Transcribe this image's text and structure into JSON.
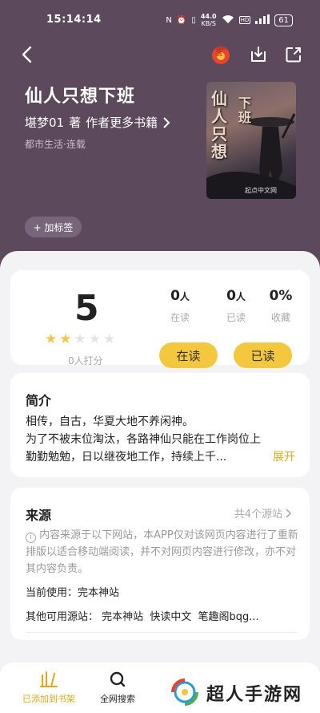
{
  "status_bar": {
    "time": "15:14:14",
    "net_speed": "44.0",
    "net_unit": "KB/S",
    "battery": "61"
  },
  "header": {
    "back_icon": "chevron-left-icon",
    "reward_icon": "red-envelope-icon",
    "reward_label": "赏",
    "download_icon": "download-icon",
    "share_icon": "share-icon"
  },
  "book": {
    "title": "仙人只想下班",
    "author": "堪梦01",
    "author_suffix": "著",
    "more_books": "作者更多书籍",
    "category": "都市生活·连载",
    "add_tag": "+ 加标签",
    "cover_text_1": "仙人只想",
    "cover_text_2": "下班",
    "cover_publisher": "起点中文网"
  },
  "rating": {
    "score": "5",
    "stars_filled": 2,
    "stars_total": 5,
    "rating_count": "0人打分"
  },
  "stats": [
    {
      "value": "0",
      "unit": "人",
      "label": "在读"
    },
    {
      "value": "0",
      "unit": "人",
      "label": "已读"
    },
    {
      "value": "0%",
      "unit": "",
      "label": "收藏"
    }
  ],
  "actions": {
    "reading": "在读",
    "read": "已读"
  },
  "intro": {
    "title": "简介",
    "line1": "相传，自古，华夏大地不养闲神。",
    "line2": "为了不被末位淘汰，各路神仙只能在工作岗位上",
    "line3": "勤勤勉勉，日以继夜地工作，持续上千...",
    "expand": "展开"
  },
  "source": {
    "title": "来源",
    "count": "共4个源站",
    "note": "内容来源于以下网站，本APP仅对该网页内容进行了重新排版以适合移动端阅读，并不对网页内容进行修改，亦不对其内容负责。",
    "current_label": "当前使用：",
    "current_value": "完本神站",
    "others_label": "其他可用源站：",
    "others": [
      "完本神站",
      "快读中文",
      "笔趣阁bqg..."
    ]
  },
  "bottom_tabs": [
    {
      "label": "已添加到书架",
      "icon": "bookshelf-icon"
    },
    {
      "label": "全网搜索",
      "icon": "search-icon"
    }
  ],
  "watermark": "超人手游网",
  "colors": {
    "hero": "#5c4a5c",
    "accent": "#f3c83e",
    "expand": "#e0a81c"
  }
}
